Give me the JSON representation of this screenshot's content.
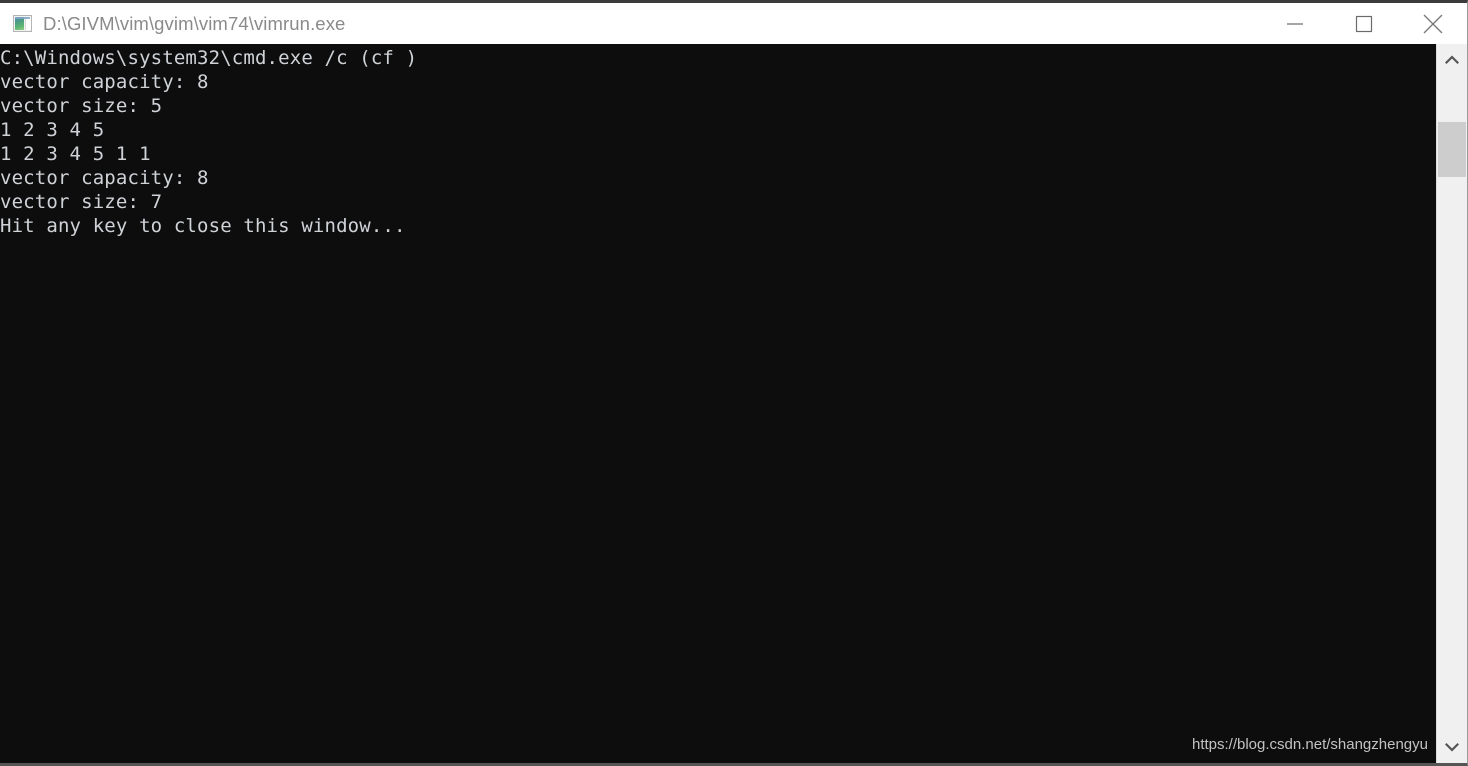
{
  "window": {
    "title": "D:\\GIVM\\vim\\gvim\\vim74\\vimrun.exe",
    "icon": "console-app-icon",
    "background_color": "#0d0d0d",
    "titlebar_color": "#ffffff",
    "text_color": "#cfd3d8"
  },
  "controls": {
    "minimize_label": "Minimize",
    "maximize_label": "Maximize",
    "close_label": "Close"
  },
  "console": {
    "lines": [
      "C:\\Windows\\system32\\cmd.exe /c (cf )",
      "vector capacity: 8",
      "vector size: 5",
      "1 2 3 4 5",
      "1 2 3 4 5 1 1",
      "vector capacity: 8",
      "vector size: 7",
      "Hit any key to close this window..."
    ],
    "text": "C:\\Windows\\system32\\cmd.exe /c (cf )\nvector capacity: 8\nvector size: 5\n1 2 3 4 5\n1 2 3 4 5 1 1\nvector capacity: 8\nvector size: 7\nHit any key to close this window..."
  },
  "watermark": {
    "url": "https://blog.csdn.net/shangzhengyu"
  },
  "scrollbar": {
    "up_arrow": "chevron-up-icon",
    "down_arrow": "chevron-down-icon",
    "thumb_position_percent": 7,
    "thumb_size_percent": 9
  }
}
